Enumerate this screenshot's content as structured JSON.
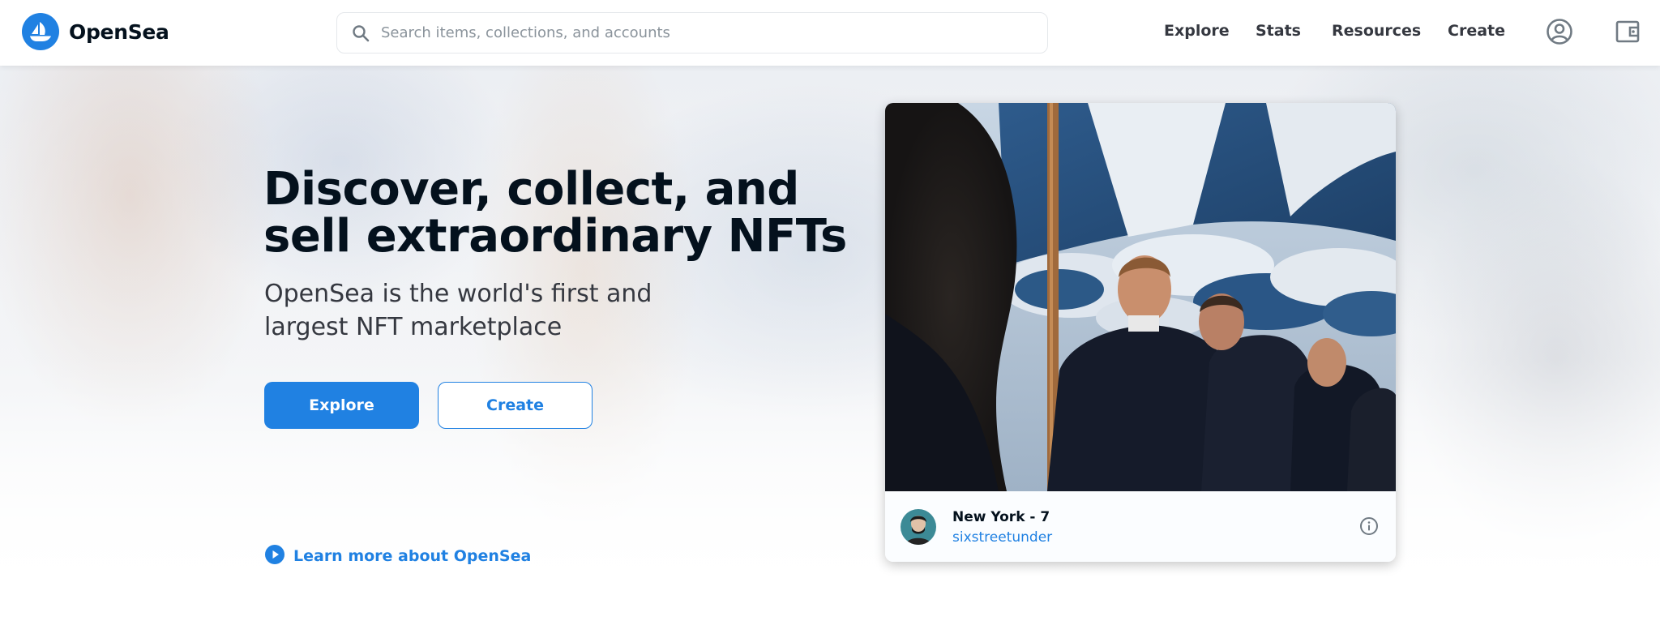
{
  "header": {
    "brand_name": "OpenSea",
    "search_placeholder": "Search items, collections, and accounts",
    "nav": [
      {
        "label": "Explore"
      },
      {
        "label": "Stats"
      },
      {
        "label": "Resources"
      },
      {
        "label": "Create"
      }
    ],
    "icons": [
      "account-icon",
      "wallet-icon"
    ]
  },
  "hero": {
    "title": "Discover, collect, and sell extraordinary NFTs",
    "subtitle": "OpenSea is the world's first and largest NFT marketplace",
    "explore_label": "Explore",
    "create_label": "Create",
    "learn_more_label": "Learn more about OpenSea"
  },
  "featured": {
    "title": "New York - 7",
    "creator": "sixstreetunder"
  },
  "colors": {
    "accent": "#2081e2",
    "text_dark": "#04111d",
    "text_body": "#353840",
    "placeholder": "#8a939b",
    "border": "#e5e8eb"
  }
}
